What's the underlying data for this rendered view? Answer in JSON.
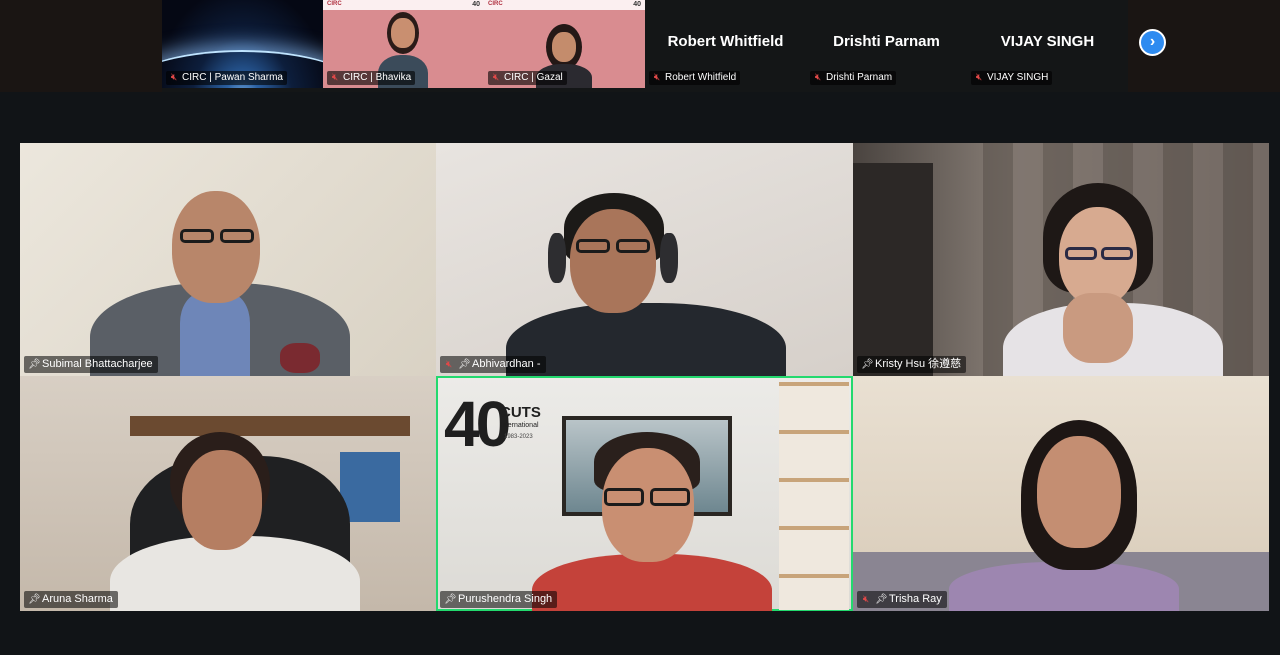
{
  "top_strip": {
    "thumbnails": [
      {
        "name": "CIRC | Pawan Sharma",
        "muted": true,
        "video": "space"
      },
      {
        "name": "CIRC | Bhavika",
        "muted": true,
        "video": "camera",
        "logo_left": "CIRC",
        "logo_right": "40"
      },
      {
        "name": "CIRC | Gazal",
        "muted": true,
        "video": "camera",
        "logo_left": "CIRC",
        "logo_right": "40"
      },
      {
        "name": "Robert Whitfield",
        "display_name": "Robert Whitfield",
        "muted": true,
        "video": "off"
      },
      {
        "name": "Drishti Parnam",
        "display_name": "Drishti Parnam",
        "muted": true,
        "video": "off"
      },
      {
        "name": "VIJAY SINGH",
        "display_name": "VIJAY SINGH",
        "muted": true,
        "video": "off"
      }
    ],
    "next_icon": "chevron-right-icon"
  },
  "gallery": {
    "tiles": [
      {
        "name": "Subimal Bhattacharjee",
        "pinned": true,
        "muted": false
      },
      {
        "name": "Abhivardhan -",
        "pinned": true,
        "muted": true
      },
      {
        "name": "Kristy Hsu 徐遵慈",
        "pinned": true,
        "muted": false
      },
      {
        "name": "Aruna Sharma",
        "pinned": true,
        "muted": false
      },
      {
        "name": "Purushendra Singh",
        "pinned": true,
        "muted": false,
        "active_speaker": true,
        "backdrop_logo": "40",
        "backdrop_logo_text": "CUTS",
        "backdrop_logo_sub": "International",
        "backdrop_years": "1983-2023"
      },
      {
        "name": "Trisha Ray",
        "pinned": true,
        "muted": true
      }
    ]
  },
  "colors": {
    "background": "#111417",
    "active_speaker_border": "#23d96e",
    "muted_icon": "#e04848",
    "next_button": "#2e8bf0"
  }
}
